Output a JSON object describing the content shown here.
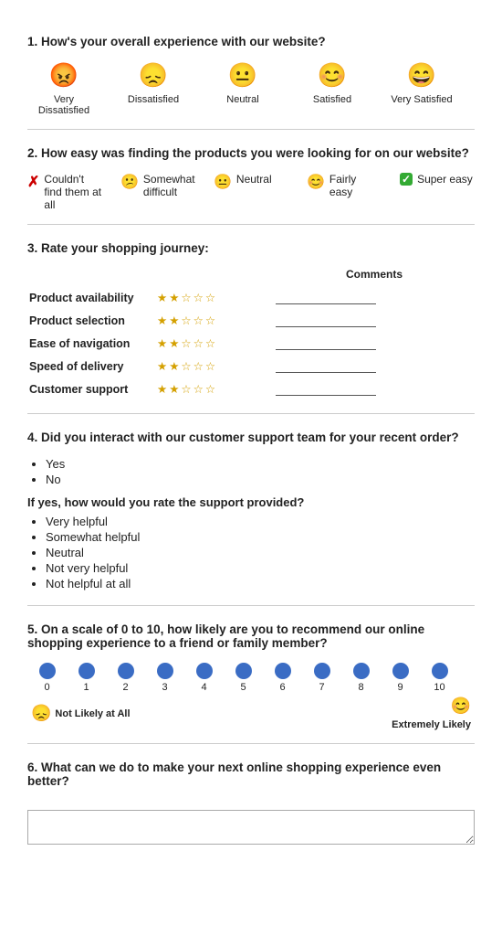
{
  "q1": {
    "title": "How's your overall experience with our website?",
    "num": "1.",
    "options": [
      {
        "label": "Very Dissatisfied",
        "emoji": "😡"
      },
      {
        "label": "Dissatisfied",
        "emoji": "😞"
      },
      {
        "label": "Neutral",
        "emoji": "😐"
      },
      {
        "label": "Satisfied",
        "emoji": "😊"
      },
      {
        "label": "Very Satisfied",
        "emoji": "😄"
      }
    ]
  },
  "q2": {
    "title": "How easy was finding the products you were looking for on our website?",
    "num": "2.",
    "options": [
      {
        "label": "Couldn't find them at all",
        "icon": "cross"
      },
      {
        "label": "Somewhat difficult",
        "icon": "emoji_sad"
      },
      {
        "label": "Neutral",
        "icon": "emoji_neutral"
      },
      {
        "label": "Fairly easy",
        "icon": "emoji_happy"
      },
      {
        "label": "Super easy",
        "icon": "check_green"
      }
    ]
  },
  "q3": {
    "title": "Rate your shopping journey:",
    "num": "3.",
    "comments_header": "Comments",
    "rows": [
      {
        "label": "Product availability"
      },
      {
        "label": "Product selection"
      },
      {
        "label": "Ease of navigation"
      },
      {
        "label": "Speed of delivery"
      },
      {
        "label": "Customer support"
      }
    ],
    "stars": "★★☆☆☆"
  },
  "q4": {
    "title": "Did you interact with our customer support team for your recent order?",
    "num": "4.",
    "yes_no": [
      "Yes",
      "No"
    ],
    "followup": "If yes, how would you rate the support provided?",
    "ratings": [
      "Very helpful",
      "Somewhat helpful",
      "Neutral",
      "Not very helpful",
      "Not helpful at all"
    ]
  },
  "q5": {
    "title": "On a scale of 0 to 10, how likely are you to recommend our online shopping experience to a friend or family member?",
    "num": "5.",
    "scale": [
      "0",
      "1",
      "2",
      "3",
      "4",
      "5",
      "6",
      "7",
      "8",
      "9",
      "10"
    ],
    "left_label": "Not Likely at All",
    "right_label": "Extremely Likely",
    "left_emoji": "😞",
    "right_emoji": "😊"
  },
  "q6": {
    "title": "What can we do to make your next online shopping experience even better?",
    "num": "6.",
    "placeholder": ""
  }
}
